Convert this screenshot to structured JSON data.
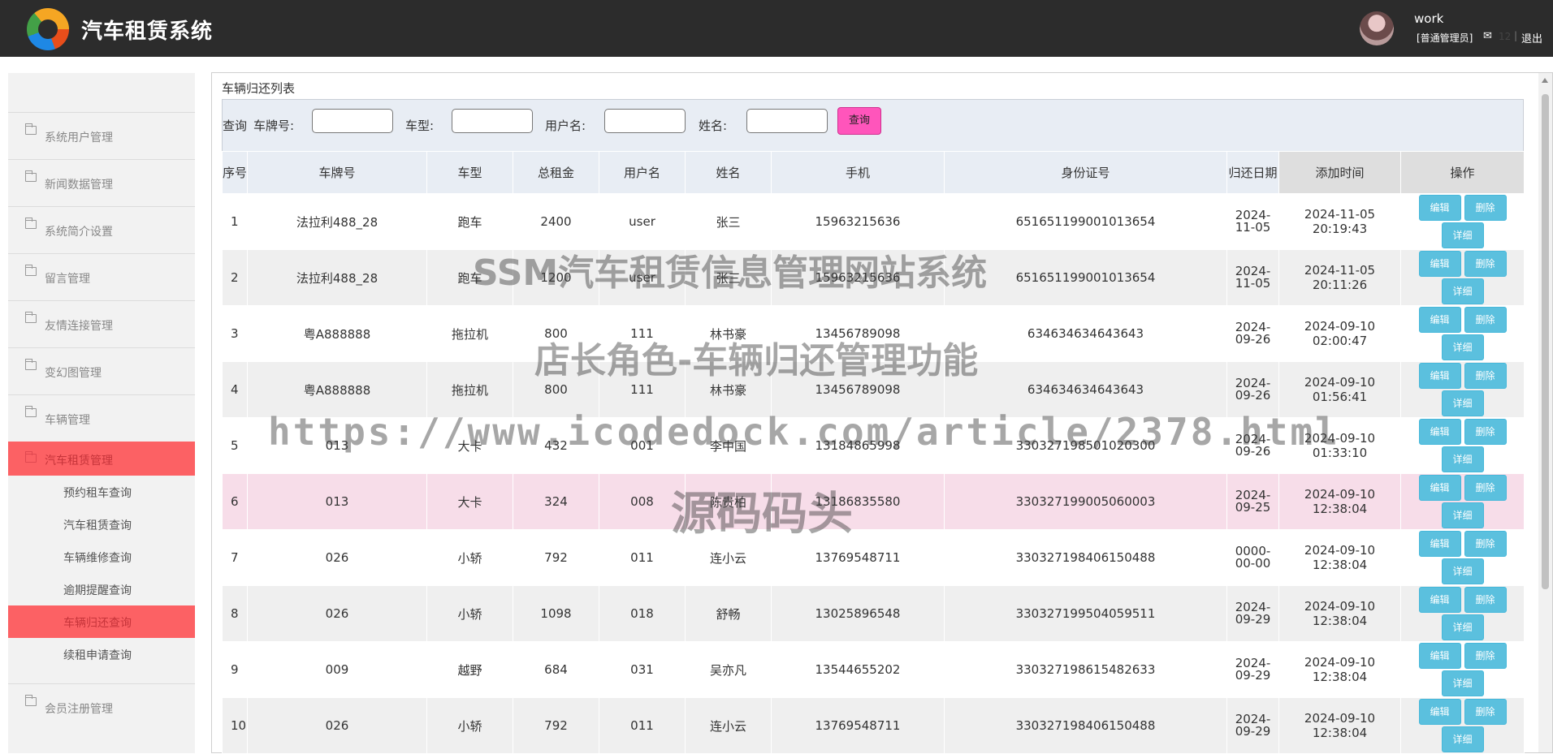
{
  "header": {
    "app_title": "汽车租赁系统",
    "user_name": "work",
    "user_role": "[普通管理员]",
    "mail_count": "12",
    "separator": "|",
    "logout_label": "退出"
  },
  "sidebar": {
    "items": [
      {
        "label": "系统用户管理"
      },
      {
        "label": "新闻数据管理"
      },
      {
        "label": "系统简介设置"
      },
      {
        "label": "留言管理"
      },
      {
        "label": "友情连接管理"
      },
      {
        "label": "变幻图管理"
      },
      {
        "label": "车辆管理"
      },
      {
        "label": "汽车租赁管理"
      },
      {
        "label": "会员注册管理"
      }
    ],
    "sub_items": [
      {
        "label": "预约租车查询"
      },
      {
        "label": "汽车租赁查询"
      },
      {
        "label": "车辆维修查询"
      },
      {
        "label": "逾期提醒查询"
      },
      {
        "label": "车辆归还查询"
      },
      {
        "label": "续租申请查询"
      }
    ]
  },
  "main": {
    "panel_title": "车辆归还列表",
    "search": {
      "prefix": "查询",
      "plate_label": "车牌号:",
      "model_label": "车型:",
      "username_label": "用户名:",
      "name_label": "姓名:",
      "button_label": "查询"
    },
    "table": {
      "headers": [
        "序号",
        "车牌号",
        "车型",
        "总租金",
        "用户名",
        "姓名",
        "手机",
        "身份证号",
        "归还日期",
        "添加时间",
        "操作"
      ],
      "rows": [
        [
          "1",
          "法拉利488_28",
          "跑车",
          "2400",
          "user",
          "张三",
          "15963215636",
          "651651199001013654",
          "2024-11-05",
          "2024-11-05 20:19:43"
        ],
        [
          "2",
          "法拉利488_28",
          "跑车",
          "1200",
          "user",
          "张三",
          "15963215636",
          "651651199001013654",
          "2024-11-05",
          "2024-11-05 20:11:26"
        ],
        [
          "3",
          "粤A888888",
          "拖拉机",
          "800",
          "111",
          "林书豪",
          "13456789098",
          "634634634643643",
          "2024-09-26",
          "2024-09-10 02:00:47"
        ],
        [
          "4",
          "粤A888888",
          "拖拉机",
          "800",
          "111",
          "林书豪",
          "13456789098",
          "634634634643643",
          "2024-09-26",
          "2024-09-10 01:56:41"
        ],
        [
          "5",
          "013",
          "大卡",
          "432",
          "001",
          "李中国",
          "13184865998",
          "330327198501020300",
          "2024-09-26",
          "2024-09-10 01:33:10"
        ],
        [
          "6",
          "013",
          "大卡",
          "324",
          "008",
          "陈贵柏",
          "13186835580",
          "330327199005060003",
          "2024-09-25",
          "2024-09-10 12:38:04"
        ],
        [
          "7",
          "026",
          "小轿",
          "792",
          "011",
          "连小云",
          "13769548711",
          "330327198406150488",
          "0000-00-00",
          "2024-09-10 12:38:04"
        ],
        [
          "8",
          "026",
          "小轿",
          "1098",
          "018",
          "舒畅",
          "13025896548",
          "330327199504059511",
          "2024-09-29",
          "2024-09-10 12:38:04"
        ],
        [
          "9",
          "009",
          "越野",
          "684",
          "031",
          "吴亦凡",
          "13544655202",
          "330327198615482633",
          "2024-09-29",
          "2024-09-10 12:38:04"
        ],
        [
          "10",
          "026",
          "小轿",
          "792",
          "011",
          "连小云",
          "13769548711",
          "330327198406150488",
          "2024-09-29",
          "2024-09-10 12:38:04"
        ]
      ],
      "actions": {
        "edit": "编辑",
        "delete": "删除",
        "detail": "详细"
      }
    }
  },
  "watermark": {
    "line1": "SSM汽车租赁信息管理网站系统",
    "line2": "店长角色-车辆归还管理功能",
    "line3": "https://www.icodedock.com/article/2378.html",
    "line4": "源码码头"
  },
  "colors": {
    "header_bg": "#2c2c2c",
    "sidebar_active": "#fc6164",
    "query_button": "#ff55bb",
    "action_button": "#5bc0de",
    "highlight_row": "#f7dde9"
  }
}
